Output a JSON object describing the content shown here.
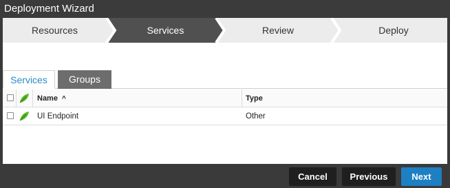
{
  "window": {
    "title": "Deployment Wizard"
  },
  "steps": [
    {
      "label": "Resources",
      "active": false
    },
    {
      "label": "Services",
      "active": true
    },
    {
      "label": "Review",
      "active": false
    },
    {
      "label": "Deploy",
      "active": false
    }
  ],
  "tabs": [
    {
      "label": "Services",
      "selected": true
    },
    {
      "label": "Groups",
      "selected": false
    }
  ],
  "table": {
    "columns": {
      "name": "Name",
      "type": "Type",
      "sort_indicator": "^"
    },
    "rows": [
      {
        "name": "UI Endpoint",
        "type": "Other"
      }
    ]
  },
  "footer": {
    "cancel_label": "Cancel",
    "previous_label": "Previous",
    "next_label": "Next"
  },
  "colors": {
    "step_active": "#505050",
    "step_inactive": "#ececec",
    "tab_selected_text": "#2a8bc5",
    "primary_button": "#1e7fc2",
    "leaf_icon": "#5cb82a"
  },
  "icons": [
    "service-leaf-icon",
    "checkbox-icon",
    "sort-ascending-icon"
  ]
}
